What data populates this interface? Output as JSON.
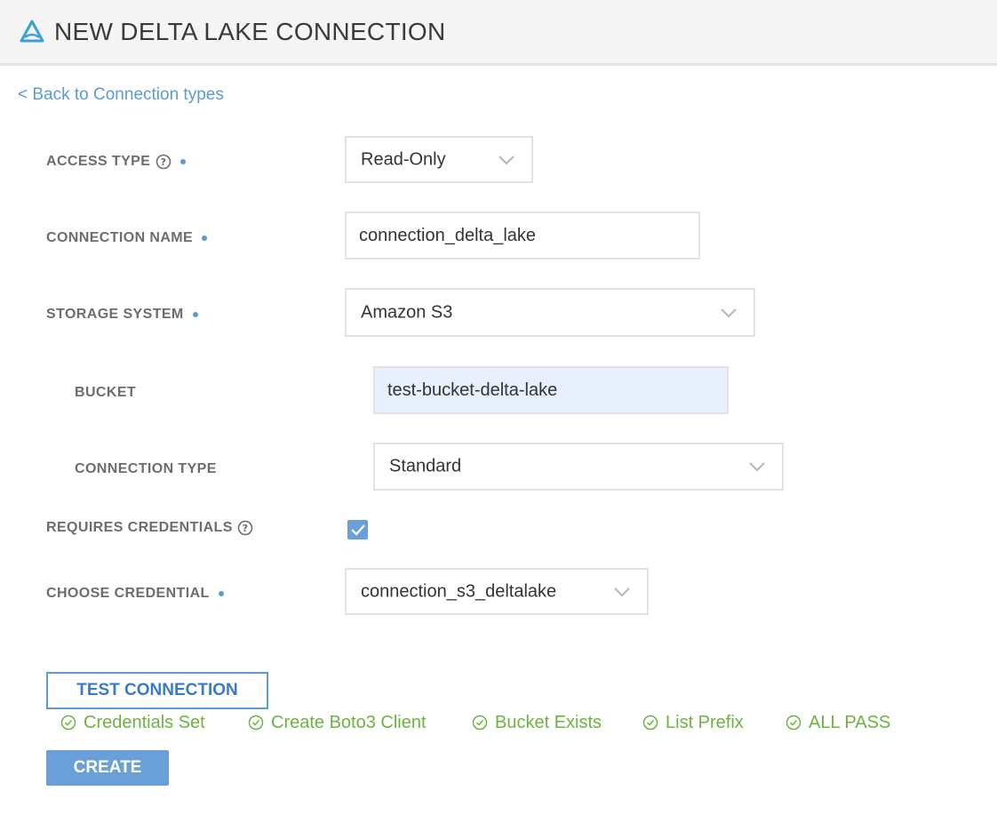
{
  "header": {
    "title": "NEW DELTA LAKE CONNECTION",
    "logo_icon": "delta-logo-icon"
  },
  "back_link": "< Back to Connection types",
  "form": {
    "access_type": {
      "label": "ACCESS TYPE",
      "value": "Read-Only"
    },
    "connection_name": {
      "label": "CONNECTION NAME",
      "value": "connection_delta_lake"
    },
    "storage_system": {
      "label": "STORAGE SYSTEM",
      "value": "Amazon S3"
    },
    "bucket": {
      "label": "BUCKET",
      "value": "test-bucket-delta-lake"
    },
    "connection_type": {
      "label": "CONNECTION TYPE",
      "value": "Standard"
    },
    "requires_credentials": {
      "label": "REQUIRES CREDENTIALS",
      "checked": true
    },
    "choose_credential": {
      "label": "CHOOSE CREDENTIAL",
      "value": "connection_s3_deltalake"
    }
  },
  "buttons": {
    "test_connection": "TEST CONNECTION",
    "create": "CREATE"
  },
  "checks": [
    {
      "label": "Credentials Set"
    },
    {
      "label": "Create Boto3 Client"
    },
    {
      "label": "Bucket Exists"
    },
    {
      "label": "List Prefix"
    },
    {
      "label": "ALL PASS"
    }
  ],
  "colors": {
    "accent": "#5b9bd5",
    "success": "#6db33f",
    "button_fill": "#6a9fd8",
    "highlight_field": "#e8f0fe"
  }
}
